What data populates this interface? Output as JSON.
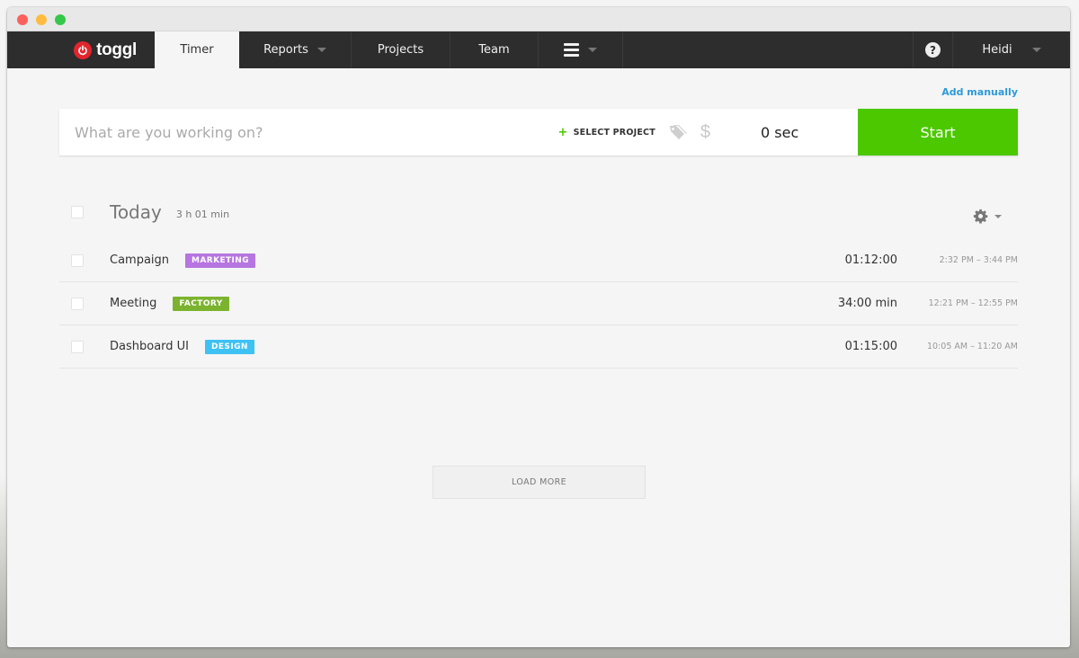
{
  "window": {
    "traffic_lights": [
      "close",
      "minimize",
      "maximize"
    ]
  },
  "nav": {
    "logo_text": "toggl",
    "items": [
      {
        "label": "Timer",
        "active": true
      },
      {
        "label": "Reports",
        "has_dropdown": true
      },
      {
        "label": "Projects"
      },
      {
        "label": "Team"
      },
      {
        "label": "",
        "icon": "hamburger-icon",
        "has_dropdown": true
      }
    ],
    "help_icon": "?",
    "user_name": "Heidi"
  },
  "timer": {
    "add_manually": "Add manually",
    "description_placeholder": "What are you working on?",
    "description_value": "",
    "select_project": "SELECT PROJECT",
    "select_project_plus": "+",
    "billable_symbol": "$",
    "duration": "0 sec",
    "start_label": "Start"
  },
  "day": {
    "title": "Today",
    "total": "3 h 01 min"
  },
  "entries": [
    {
      "description": "Campaign",
      "project": "MARKETING",
      "project_color": "#b675e0",
      "duration": "01:12:00",
      "range": "2:32 PM – 3:44 PM"
    },
    {
      "description": "Meeting",
      "project": "FACTORY",
      "project_color": "#7cb32e",
      "duration": "34:00 min",
      "range": "12:21 PM – 12:55 PM"
    },
    {
      "description": "Dashboard UI",
      "project": "DESIGN",
      "project_color": "#3ec1f3",
      "duration": "01:15:00",
      "range": "10:05 AM – 11:20 AM"
    }
  ],
  "load_more": "LOAD MORE",
  "colors": {
    "brand_red": "#e2252c",
    "start_green": "#4bc800",
    "link_blue": "#2d9ad9",
    "nav_bg": "#2d2d2d"
  }
}
